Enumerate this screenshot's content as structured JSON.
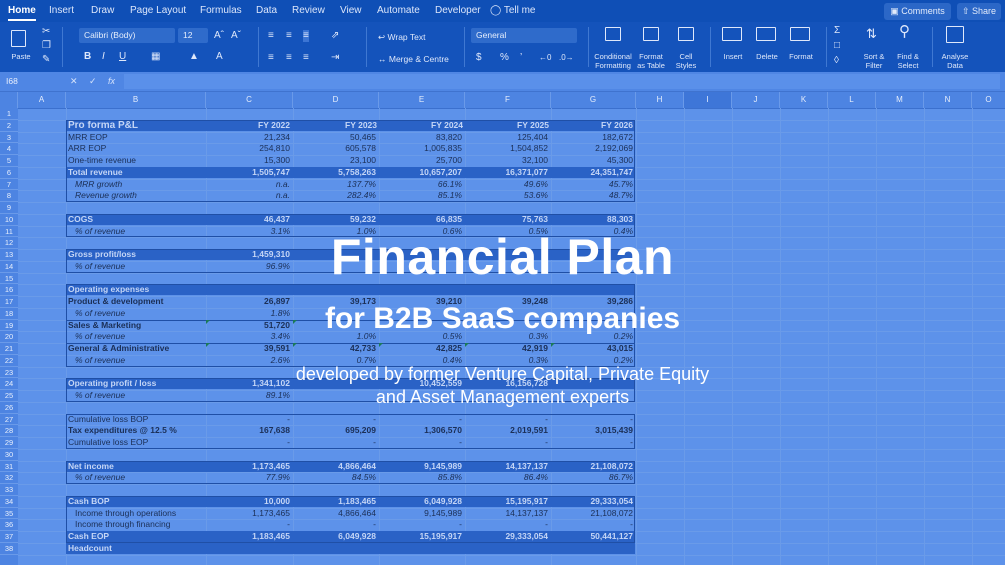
{
  "tabs": [
    "Home",
    "Insert",
    "Draw",
    "Page Layout",
    "Formulas",
    "Data",
    "Review",
    "View",
    "Automate",
    "Developer"
  ],
  "tell_me": "Tell me",
  "buttons": {
    "comments": "Comments",
    "share": "Share"
  },
  "ribbon": {
    "paste": "Paste",
    "font_name": "Calibri (Body)",
    "font_size": "12",
    "bold": "B",
    "italic": "I",
    "underline": "U",
    "wrap_text": "Wrap Text",
    "merge_centre": "Merge & Centre",
    "number_format": "General",
    "currency": "$",
    "percent": "%",
    "comma": "’",
    "conditional_formatting": [
      "Conditional",
      "Formatting"
    ],
    "format_as_table": [
      "Format",
      "as Table"
    ],
    "cell_styles": [
      "Cell",
      "Styles"
    ],
    "insert": "Insert",
    "delete": "Delete",
    "format": "Format",
    "sort_filter": [
      "Sort &",
      "Filter"
    ],
    "find_select": [
      "Find &",
      "Select"
    ],
    "analyse_data": [
      "Analyse",
      "Data"
    ]
  },
  "formula_bar": {
    "name_box": "I68",
    "fx": "fx"
  },
  "columns": [
    "A",
    "B",
    "C",
    "D",
    "E",
    "F",
    "G",
    "H",
    "I",
    "J",
    "K",
    "L",
    "M",
    "N",
    "O"
  ],
  "rows": [
    "1",
    "2",
    "3",
    "4",
    "5",
    "6",
    "7",
    "8",
    "9",
    "10",
    "11",
    "12",
    "13",
    "14",
    "15",
    "16",
    "17",
    "18",
    "19",
    "20",
    "21",
    "22",
    "23",
    "24",
    "25",
    "26",
    "27",
    "28",
    "29",
    "30",
    "31",
    "32",
    "33",
    "34",
    "35",
    "36",
    "37",
    "38"
  ],
  "sheet": {
    "title": "Pro forma P&L",
    "years": [
      "FY 2022",
      "FY 2023",
      "FY 2024",
      "FY 2025",
      "FY 2026"
    ],
    "mrr": {
      "label": "MRR EOP",
      "values": [
        "21,234",
        "50,465",
        "83,820",
        "125,404",
        "182,672"
      ]
    },
    "arr": {
      "label": "ARR EOP",
      "values": [
        "254,810",
        "605,578",
        "1,005,835",
        "1,504,852",
        "2,192,069"
      ]
    },
    "onetime": {
      "label": "One-time revenue",
      "values": [
        "15,300",
        "23,100",
        "25,700",
        "32,100",
        "45,300"
      ]
    },
    "total_revenue": {
      "label": "Total revenue",
      "values": [
        "1,505,747",
        "5,758,263",
        "10,657,207",
        "16,371,077",
        "24,351,747"
      ]
    },
    "mrr_growth": {
      "label": "MRR growth",
      "values": [
        "n.a.",
        "137.7%",
        "66.1%",
        "49.6%",
        "45.7%"
      ]
    },
    "revenue_growth": {
      "label": "Revenue growth",
      "values": [
        "n.a.",
        "282.4%",
        "85.1%",
        "53.6%",
        "48.7%"
      ]
    },
    "cogs": {
      "label": "COGS",
      "values": [
        "46,437",
        "59,232",
        "66,835",
        "75,763",
        "88,303"
      ]
    },
    "cogs_pct": {
      "label": "% of revenue",
      "values": [
        "3.1%",
        "1.0%",
        "0.6%",
        "0.5%",
        "0.4%"
      ]
    },
    "gross_profit": {
      "label": "Gross profit/loss",
      "values": [
        "1,459,310",
        "",
        "",
        "",
        ""
      ]
    },
    "gross_pct": {
      "label": "% of revenue",
      "values": [
        "96.9%",
        "",
        "",
        "",
        ""
      ]
    },
    "opex_title": "Operating expenses",
    "product_dev": {
      "label": "Product & development",
      "values": [
        "26,897",
        "39,173",
        "39,210",
        "39,248",
        "39,286"
      ]
    },
    "product_dev_pct": {
      "label": "% of revenue",
      "values": [
        "1.8%",
        "",
        "",
        "",
        ""
      ]
    },
    "sales_marketing": {
      "label": "Sales & Marketing",
      "values": [
        "51,720",
        "",
        "",
        "",
        ""
      ]
    },
    "sales_pct": {
      "label": "% of revenue",
      "values": [
        "3.4%",
        "1.0%",
        "0.5%",
        "0.3%",
        "0.2%"
      ]
    },
    "general_admin": {
      "label": "General & Administrative",
      "values": [
        "39,591",
        "42,733",
        "42,825",
        "42,919",
        "43,015"
      ]
    },
    "general_pct": {
      "label": "% of revenue",
      "values": [
        "2.6%",
        "0.7%",
        "0.4%",
        "0.3%",
        "0.2%"
      ]
    },
    "operating_profit": {
      "label": "Operating profit / loss",
      "values": [
        "1,341,102",
        "",
        "10,452,559",
        "16,156,728",
        ""
      ]
    },
    "operating_pct": {
      "label": "% of revenue",
      "values": [
        "89.1%",
        "",
        "",
        "",
        ""
      ]
    },
    "cum_loss_bop": {
      "label": "Cumulative loss BOP",
      "values": [
        "-",
        "-",
        "-",
        "-",
        "-"
      ]
    },
    "tax": {
      "label": "Tax expenditures @ 12.5 %",
      "values": [
        "167,638",
        "695,209",
        "1,306,570",
        "2,019,591",
        "3,015,439"
      ]
    },
    "cum_loss_eop": {
      "label": "Cumulative loss EOP",
      "values": [
        "-",
        "-",
        "-",
        "-",
        "-"
      ]
    },
    "net_income": {
      "label": "Net income",
      "values": [
        "1,173,465",
        "4,866,464",
        "9,145,989",
        "14,137,137",
        "21,108,072"
      ]
    },
    "net_pct": {
      "label": "% of revenue",
      "values": [
        "77.9%",
        "84.5%",
        "85.8%",
        "86.4%",
        "86.7%"
      ]
    },
    "cash_bop": {
      "label": "Cash BOP",
      "values": [
        "10,000",
        "1,183,465",
        "6,049,928",
        "15,195,917",
        "29,333,054"
      ]
    },
    "income_ops": {
      "label": "Income through operations",
      "values": [
        "1,173,465",
        "4,866,464",
        "9,145,989",
        "14,137,137",
        "21,108,072"
      ]
    },
    "income_fin": {
      "label": "Income through financing",
      "values": [
        "-",
        "-",
        "-",
        "-",
        "-"
      ]
    },
    "cash_eop": {
      "label": "Cash EOP",
      "values": [
        "1,183,465",
        "6,049,928",
        "15,195,917",
        "29,333,054",
        "50,441,127"
      ]
    },
    "headcount": "Headcount"
  },
  "overlay": {
    "title": "Financial Plan",
    "subtitle": "for B2B SaaS companies",
    "line1": "developed by former Venture Capital, Private Equity",
    "line2": "and Asset Management experts"
  }
}
